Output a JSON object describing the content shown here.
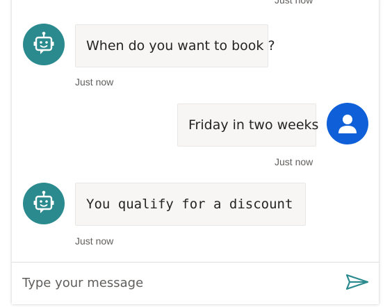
{
  "colors": {
    "bot_avatar": "#2b8a8e",
    "user_avatar": "#0f5fd9",
    "send_icon": "#2b8a8e"
  },
  "transcript": {
    "top_timestamp": "Just now",
    "messages": [
      {
        "sender": "bot",
        "icon": "robot-icon",
        "text": "When do you want to book ?",
        "timestamp": "Just now"
      },
      {
        "sender": "user",
        "icon": "person-icon",
        "text": "Friday in two weeks",
        "timestamp": "Just now"
      },
      {
        "sender": "bot",
        "icon": "robot-icon",
        "text": "You qualify for a discount",
        "timestamp": "Just now"
      }
    ]
  },
  "composer": {
    "placeholder": "Type your message",
    "send_icon": "send-icon"
  }
}
